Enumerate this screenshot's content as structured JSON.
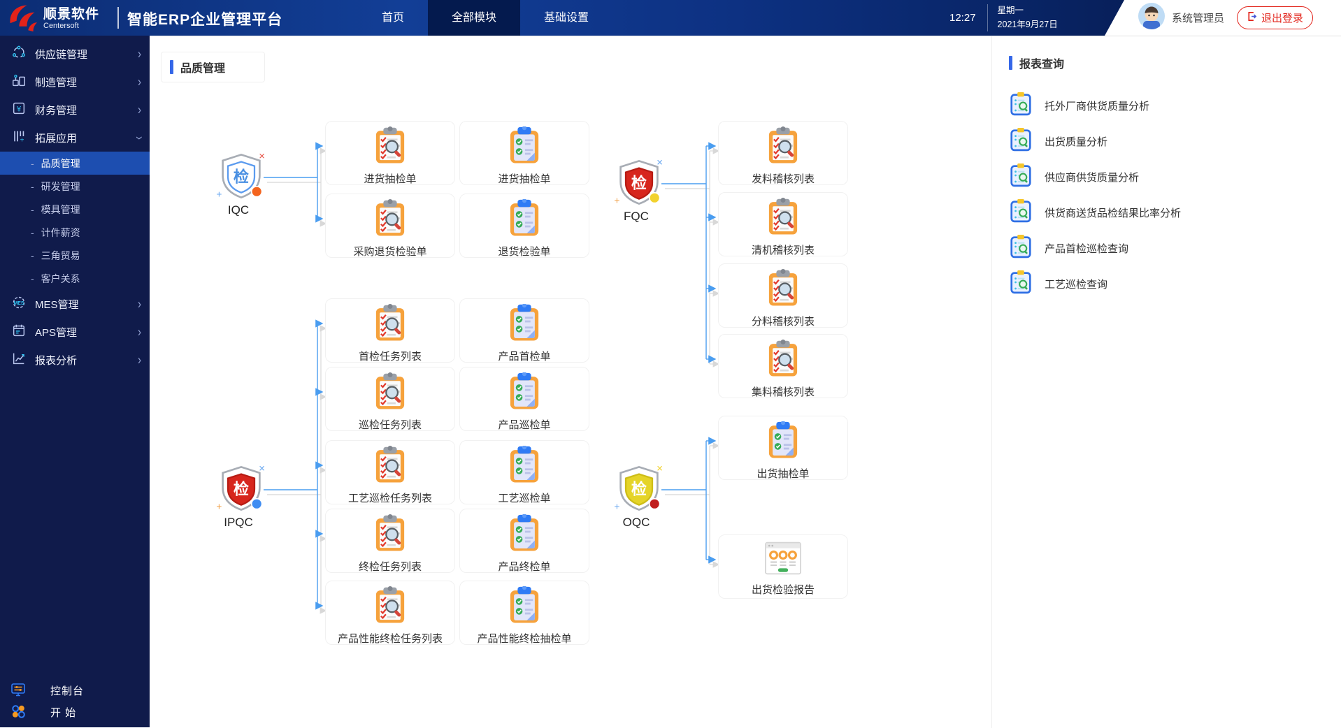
{
  "header": {
    "logo_title": "顺景软件",
    "logo_subtitle": "Centersoft",
    "app_title": "智能ERP企业管理平台",
    "nav": [
      {
        "label": "首页",
        "active": false
      },
      {
        "label": "全部模块",
        "active": true
      },
      {
        "label": "基础设置",
        "active": false
      }
    ],
    "time": "12:27",
    "weekday": "星期一",
    "date": "2021年9月27日",
    "user_name": "系统管理员",
    "logout_label": "退出登录"
  },
  "sidebar": {
    "items": [
      {
        "label": "供应链管理",
        "icon": "supply-chain-icon",
        "chevron": "right"
      },
      {
        "label": "制造管理",
        "icon": "manufacturing-icon",
        "chevron": "right"
      },
      {
        "label": "财务管理",
        "icon": "finance-icon",
        "chevron": "right"
      },
      {
        "label": "拓展应用",
        "icon": "extension-icon",
        "chevron": "down",
        "expanded": true,
        "children": [
          {
            "label": "品质管理",
            "active": true
          },
          {
            "label": "研发管理",
            "active": false
          },
          {
            "label": "模具管理",
            "active": false
          },
          {
            "label": "计件薪资",
            "active": false
          },
          {
            "label": "三角贸易",
            "active": false
          },
          {
            "label": "客户关系",
            "active": false
          }
        ]
      },
      {
        "label": "MES管理",
        "icon": "mes-icon",
        "chevron": "right"
      },
      {
        "label": "APS管理",
        "icon": "aps-icon",
        "chevron": "right"
      },
      {
        "label": "报表分析",
        "icon": "report-analysis-icon",
        "chevron": "right"
      }
    ],
    "footer": [
      {
        "label": "控制台",
        "icon": "console-icon"
      },
      {
        "label": "开 始",
        "icon": "start-icon"
      }
    ]
  },
  "main": {
    "title": "品质管理",
    "flow": {
      "groups": [
        {
          "id": "iqc",
          "label": "IQC",
          "shield": {
            "inner": "#ffffff",
            "stroke": "#5b9bef",
            "glyph": "检",
            "glyph_color": "#4a90e2",
            "dot": "#f4641e",
            "cross": "#e85a4f",
            "plus": "#6aa8f0"
          },
          "rows": [
            {
              "nodes": [
                {
                  "icon": "clipboard-inspect-icon",
                  "label": "进货抽检单"
                },
                {
                  "icon": "clipboard-form-icon",
                  "label": "进货抽检单"
                }
              ]
            },
            {
              "nodes": [
                {
                  "icon": "clipboard-inspect-icon",
                  "label": "采购退货检验单"
                },
                {
                  "icon": "clipboard-form-icon",
                  "label": "退货检验单"
                }
              ]
            }
          ]
        },
        {
          "id": "fqc",
          "label": "FQC",
          "shield": {
            "inner": "#d7261d",
            "stroke": "#b71c14",
            "glyph": "检",
            "glyph_color": "#ffffff",
            "dot": "#f2d22e",
            "cross": "#6aa8f0",
            "plus": "#f0a24a"
          },
          "rows": [
            {
              "nodes": [
                {
                  "icon": "clipboard-inspect-icon",
                  "label": "发料稽核列表"
                }
              ]
            },
            {
              "nodes": [
                {
                  "icon": "clipboard-inspect-icon",
                  "label": "清机稽核列表"
                }
              ]
            },
            {
              "nodes": [
                {
                  "icon": "clipboard-inspect-icon",
                  "label": "分料稽核列表"
                }
              ]
            },
            {
              "nodes": [
                {
                  "icon": "clipboard-inspect-icon",
                  "label": "集料稽核列表"
                }
              ]
            }
          ]
        },
        {
          "id": "ipqc",
          "label": "IPQC",
          "shield": {
            "inner": "#d7261d",
            "stroke": "#b71c14",
            "glyph": "检",
            "glyph_color": "#ffffff",
            "dot": "#3f8df2",
            "cross": "#6aa8f0",
            "plus": "#f0a24a"
          },
          "rows": [
            {
              "nodes": [
                {
                  "icon": "clipboard-inspect-icon",
                  "label": "首检任务列表"
                },
                {
                  "icon": "clipboard-form-icon",
                  "label": "产品首检单"
                }
              ]
            },
            {
              "nodes": [
                {
                  "icon": "clipboard-inspect-icon",
                  "label": "巡检任务列表"
                },
                {
                  "icon": "clipboard-form-icon",
                  "label": "产品巡检单"
                }
              ]
            },
            {
              "nodes": [
                {
                  "icon": "clipboard-inspect-icon",
                  "label": "工艺巡检任务列表"
                },
                {
                  "icon": "clipboard-form-icon",
                  "label": "工艺巡检单"
                }
              ]
            },
            {
              "nodes": [
                {
                  "icon": "clipboard-inspect-icon",
                  "label": "终检任务列表"
                },
                {
                  "icon": "clipboard-form-icon",
                  "label": "产品终检单"
                }
              ]
            },
            {
              "nodes": [
                {
                  "icon": "clipboard-inspect-icon",
                  "label": "产品性能终检任务列表"
                },
                {
                  "icon": "clipboard-form-icon",
                  "label": "产品性能终检抽检单"
                }
              ]
            }
          ]
        },
        {
          "id": "oqc",
          "label": "OQC",
          "shield": {
            "inner": "#e5d428",
            "stroke": "#cdbd17",
            "glyph": "检",
            "glyph_color": "#ffffff",
            "dot": "#c01d1d",
            "cross": "#f2d22e",
            "plus": "#6aa8f0"
          },
          "rows": [
            {
              "nodes": [
                {
                  "icon": "clipboard-form-icon",
                  "label": "出货抽检单"
                }
              ]
            },
            {
              "nodes": [
                {
                  "icon": "report-window-icon",
                  "label": "出货检验报告"
                }
              ]
            }
          ]
        }
      ]
    },
    "report_panel": {
      "title": "报表查询",
      "items": [
        {
          "icon": "report-query-icon",
          "label": "托外厂商供货质量分析"
        },
        {
          "icon": "report-query-icon",
          "label": "出货质量分析"
        },
        {
          "icon": "report-query-icon",
          "label": "供应商供货质量分析"
        },
        {
          "icon": "report-query-icon",
          "label": "供货商送货品检结果比率分析"
        },
        {
          "icon": "report-query-icon",
          "label": "产品首检巡检查询"
        },
        {
          "icon": "report-query-icon",
          "label": "工艺巡检查询"
        }
      ]
    }
  },
  "colors": {
    "accent_blue": "#3567e8",
    "logout_red": "#e2231a",
    "connector_blue": "#4a9df0",
    "connector_shadow": "#c8c8c8",
    "sidebar_active": "#1d4eb0",
    "clipboard_orange": "#f6a23c",
    "topbar_navy": "#0c2d74"
  }
}
